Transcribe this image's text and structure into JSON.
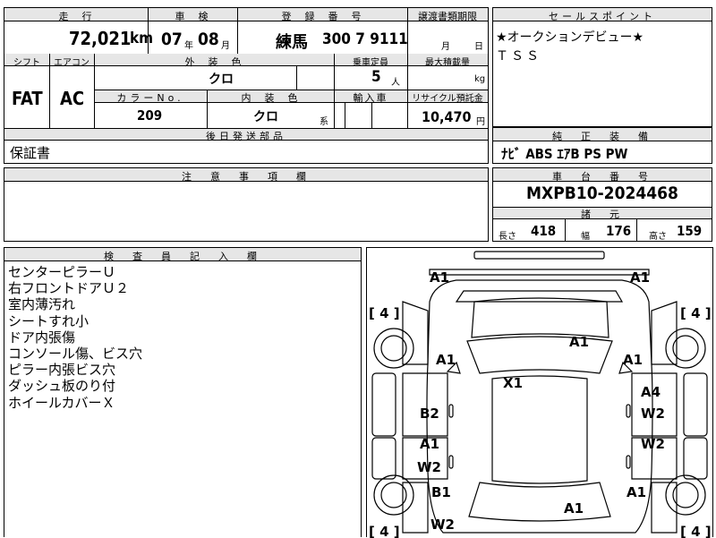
{
  "labels": {
    "mileage": "走　行",
    "inspection": "車　検",
    "registration": "登　録　番　号",
    "transfer_deadline": "譲渡書類期限",
    "sales_point": "セールスポイント",
    "shift": "シフト",
    "aircon": "エアコン",
    "exterior_color": "外　装　色",
    "capacity": "乗車定員",
    "max_load": "最大積載量",
    "color_no": "カラーNo.",
    "interior_color": "内　装　色",
    "import": "輸入車",
    "recycle_fee": "リサイクル預託金",
    "later_parts": "後日発送部品",
    "genuine_equipment": "純　正　装　備",
    "notes": "注　意　事　項　欄",
    "chassis_number": "車　台　番　号",
    "specs": "諸　元",
    "inspector_notes": "検　査　員　記　入　欄"
  },
  "vehicle": {
    "mileage_value": "72,021",
    "mileage_unit": "km",
    "inspection_year": "07",
    "inspection_year_unit": "年",
    "inspection_month": "08",
    "inspection_month_unit": "月",
    "registration_area": "練馬",
    "registration_number": "300 7 9111",
    "transfer_month_unit": "月",
    "transfer_day_unit": "日",
    "shift_value": "FAT",
    "aircon_value": "AC",
    "exterior_color_value": "クロ",
    "capacity_value": "5",
    "capacity_unit": "人",
    "max_load_unit": "kg",
    "color_no_value": "209",
    "interior_color_value": "クロ",
    "interior_color_suffix": "系",
    "recycle_fee_value": "10,470",
    "recycle_fee_unit": "円",
    "chassis_number_value": "MXPB10-2024468",
    "length_label": "長さ",
    "length_value": "418",
    "width_label": "幅",
    "width_value": "176",
    "height_label": "高さ",
    "height_value": "159"
  },
  "sales_points": [
    "★オークションデビュー★",
    "ＴＳＳ"
  ],
  "later_parts_value": "保証書",
  "genuine_equipment_value": "ﾅﾋﾞ ABS ｴｱB PS PW",
  "inspector_notes_lines": [
    "センターピラーＵ",
    "右フロントドアＵ２",
    "室内薄汚れ",
    "シートすれ小",
    "ドア内張傷",
    "コンソール傷、ビス穴",
    "ピラー内張ビス穴",
    "ダッシュ板のり付",
    "ホイールカバーＸ"
  ],
  "diagram_marks": {
    "front_left_bumper": "A1",
    "front_right_bumper": "A1",
    "tire_front_left": "[ 4 ]",
    "tire_front_right": "[ 4 ]",
    "tire_rear_left": "[ 4 ]",
    "tire_rear_right": "[ 4 ]",
    "hood": "A1",
    "front_left_fender": "A1",
    "front_right_fender": "A1",
    "roof": "X1",
    "front_right_door_1": "A4",
    "front_right_door_2": "W2",
    "front_left_door": "B2",
    "rear_left_door_1": "A1",
    "rear_left_door_2": "W2",
    "rear_right_door": "W2",
    "rear_left_fender": "B1",
    "rear_right_fender": "A1",
    "rear_left_quarter": "W2",
    "trunk": "A1"
  }
}
